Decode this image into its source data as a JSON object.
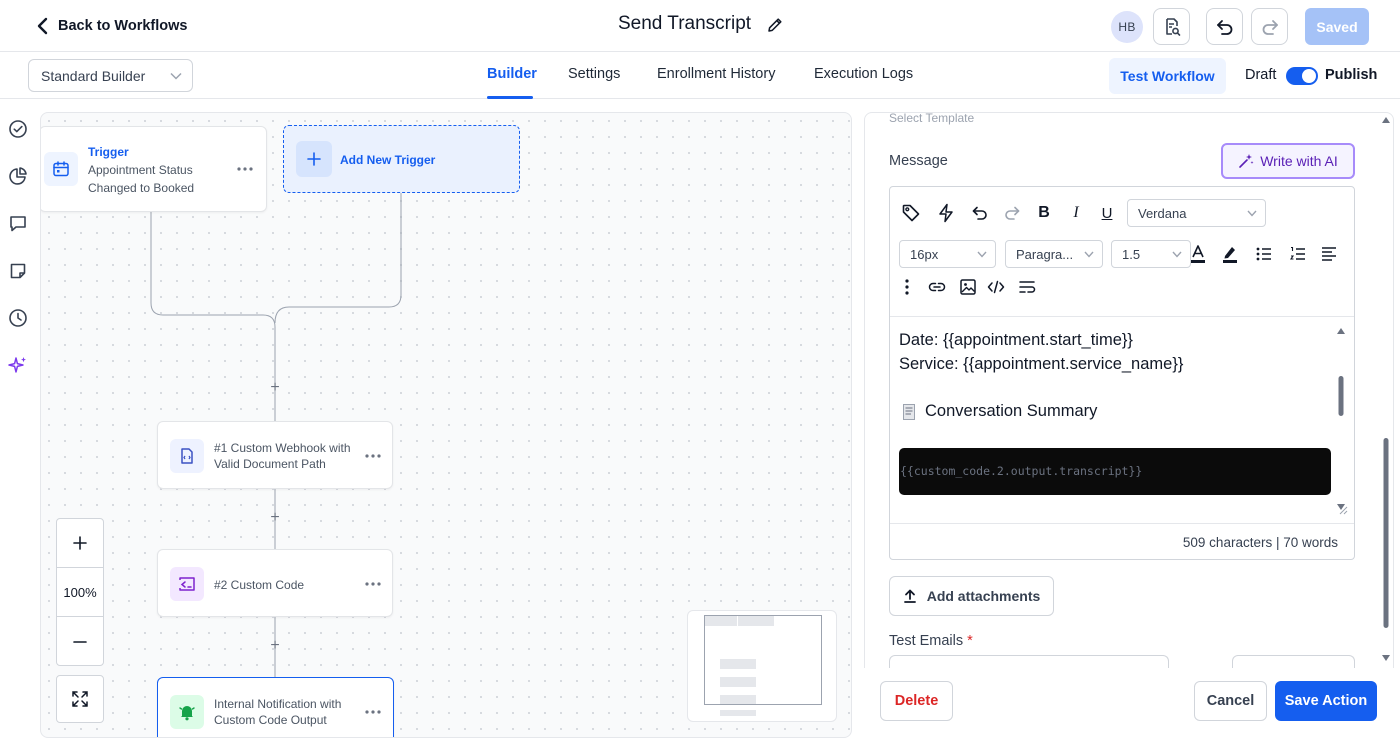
{
  "header": {
    "back_label": "Back to Workflows",
    "title": "Send Transcript",
    "avatar_initials": "HB",
    "saved_label": "Saved"
  },
  "subheader": {
    "builder_mode": "Standard Builder",
    "tabs": [
      {
        "label": "Builder",
        "active": true
      },
      {
        "label": "Settings",
        "active": false
      },
      {
        "label": "Enrollment History",
        "active": false
      },
      {
        "label": "Execution Logs",
        "active": false
      }
    ],
    "test_workflow_label": "Test Workflow",
    "draft_label": "Draft",
    "publish_label": "Publish",
    "publish_enabled": true
  },
  "rail": {
    "icons": [
      "check-circle-icon",
      "pie-chart-icon",
      "chat-bubble-icon",
      "note-icon",
      "clock-icon",
      "sparkles-icon"
    ]
  },
  "canvas": {
    "trigger": {
      "heading": "Trigger",
      "line1": "Appointment Status",
      "line2": "Changed to Booked"
    },
    "add_trigger_label": "Add New Trigger",
    "steps": [
      {
        "line1": "#1 Custom Webhook with",
        "line2": "Valid Document Path",
        "icon": "document-icon"
      },
      {
        "line1": "#2 Custom Code",
        "line2": "",
        "icon": "code-icon"
      },
      {
        "line1": "Internal Notification with",
        "line2": "Custom Code Output",
        "icon": "bell-icon"
      }
    ],
    "zoom_level": "100%"
  },
  "panel": {
    "select_template_label": "Select Template",
    "message_label": "Message",
    "write_ai_label": "Write with AI",
    "toolbar": {
      "font_family": "Verdana",
      "font_size": "16px",
      "block_format": "Paragra...",
      "line_height": "1.5"
    },
    "content": {
      "date_line": "Date: {{appointment.start_time}}",
      "service_line": "Service: {{appointment.service_name}}",
      "summary_heading": "Conversation Summary",
      "code_value": "{{custom_code.2.output.transcript}}"
    },
    "counter": "509 characters | 70 words",
    "add_attachments_label": "Add attachments",
    "test_emails_label": "Test Emails",
    "test_emails_required_mark": "*",
    "delete_label": "Delete",
    "cancel_label": "Cancel",
    "save_label": "Save Action"
  },
  "colors": {
    "primary": "#155eef",
    "ai_purple": "#5b21b6",
    "danger": "#dc2626",
    "notification_green": "#16a34a"
  }
}
